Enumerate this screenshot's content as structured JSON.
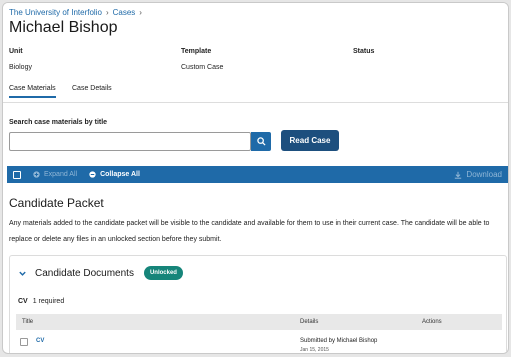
{
  "breadcrumb": [
    "The University of Interfolio",
    "Cases"
  ],
  "page": {
    "title": "Michael Bishop",
    "labels": {
      "unit": "Unit",
      "template": "Template",
      "status": "Status"
    },
    "values": {
      "unit": "Biology",
      "template": "Custom Case",
      "status": ""
    }
  },
  "tabs": [
    {
      "label": "Case Materials",
      "active": true
    },
    {
      "label": "Case Details",
      "active": false
    }
  ],
  "search": {
    "label": "Search case materials by title",
    "placeholder": "",
    "value": "",
    "button_icon": "search-icon",
    "read_case_label": "Read Case"
  },
  "toolbar": {
    "expand_all": "Expand All",
    "collapse_all": "Collapse All",
    "download": "Download",
    "accent": "#1f6aa8"
  },
  "packet": {
    "title": "Candidate Packet",
    "description": "Any materials added to the candidate packet will be visible to the candidate and available for them to use in their current case. The candidate will be able to replace or delete any files in an unlocked section before they submit."
  },
  "section": {
    "title": "Candidate Documents",
    "badge": "Unlocked",
    "badge_color": "#16857a",
    "requirement_name": "CV",
    "requirement_text": "1 required",
    "columns": {
      "title": "Title",
      "details": "Details",
      "actions": "Actions"
    },
    "rows": [
      {
        "title": "CV",
        "details": "Submitted by Michael Bishop",
        "date": "Jan 15, 2015"
      }
    ]
  }
}
